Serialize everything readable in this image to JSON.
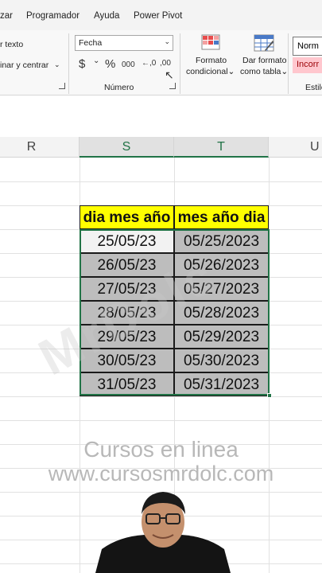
{
  "ribbon_tabs": [
    "zar",
    "Programador",
    "Ayuda",
    "Power Pivot"
  ],
  "ribbon": {
    "wrap_text_label": "r texto",
    "merge_label": "inar y centrar",
    "number_format_value": "Fecha",
    "currency_symbol": "$",
    "percent_symbol": "%",
    "thousands_symbol": "000",
    "inc_decimal_label": ",0",
    "dec_decimal_label": ",00",
    "number_group_label": "Número",
    "conditional_format_line1": "Formato",
    "conditional_format_line2": "condicional",
    "table_format_line1": "Dar formato",
    "table_format_line2": "como tabla",
    "style_normal": "Norm",
    "style_bad": "Incorr",
    "styles_group_label": "Estilo"
  },
  "columns": [
    "R",
    "S",
    "T",
    "U"
  ],
  "table": {
    "headers": [
      "dia mes año",
      "mes año dia"
    ],
    "rows": [
      [
        "25/05/23",
        "05/25/2023"
      ],
      [
        "26/05/23",
        "05/26/2023"
      ],
      [
        "27/05/23",
        "05/27/2023"
      ],
      [
        "28/05/23",
        "05/28/2023"
      ],
      [
        "29/05/23",
        "05/29/2023"
      ],
      [
        "30/05/23",
        "05/30/2023"
      ],
      [
        "31/05/23",
        "05/31/2023"
      ]
    ]
  },
  "overlay": {
    "line1": "Cursos en linea",
    "line2": "www.cursosmrdolc.com"
  },
  "colors": {
    "header_fill": "#ffff00",
    "selection": "#217346",
    "cell_fill": "#bdbdbd",
    "bad_style": "#ffc7ce"
  }
}
